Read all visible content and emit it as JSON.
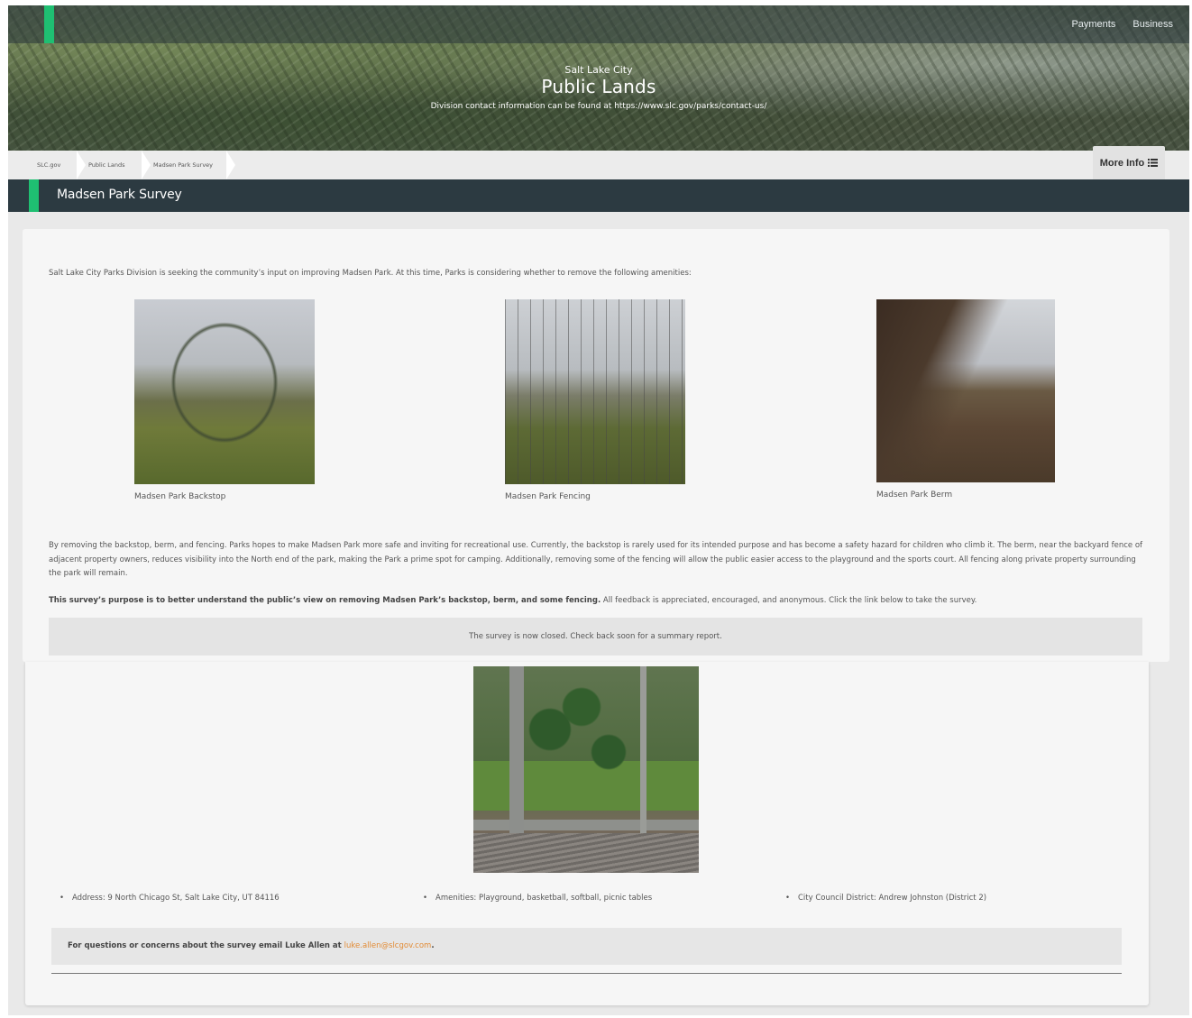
{
  "header": {
    "nav_links": [
      "Payments",
      "Business"
    ],
    "small_title": "Salt Lake City",
    "title": "Public Lands",
    "contact": "Division contact information can be found at https://www.slc.gov/parks/contact-us/"
  },
  "breadcrumb": {
    "items": [
      "SLC.gov",
      "Public Lands",
      "Madsen Park Survey"
    ],
    "more_info": "More Info"
  },
  "page_title": "Madsen Park Survey",
  "content": {
    "intro": "Salt Lake City Parks Division is seeking the community’s input on improving Madsen Park. At this time, Parks is considering whether to remove the following amenities:",
    "photos": [
      {
        "caption": "Madsen Park Backstop"
      },
      {
        "caption": "Madsen Park Fencing"
      },
      {
        "caption": "Madsen Park Berm"
      }
    ],
    "paragraph": "By removing the backstop, berm, and fencing. Parks hopes to make Madsen Park more safe and inviting for recreational use. Currently, the backstop is rarely used for its intended purpose and has become a safety hazard for children who climb it. The berm, near the backyard fence of adjacent property owners, reduces visibility into the North end of the park, making the Park a prime spot for camping. Additionally, removing some of the fencing will allow the public easier access to the playground and the sports court. All fencing along private property surrounding the park will remain.",
    "purpose_bold": "This survey’s purpose is to better understand the public’s view on removing Madsen Park’s backstop, berm, and some fencing.",
    "purpose_rest": " All feedback is appreciated, encouraged, and anonymous. Click the link below to take the survey.",
    "survey_status": "The survey is now closed. Check back soon for a summary report.",
    "facts": [
      "Address: 9 North Chicago St, Salt Lake City, UT 84116",
      "Amenities: Playground, basketball, softball, picnic tables",
      "City Council District: Andrew Johnston (District 2)"
    ],
    "contact_prefix": "For questions or concerns about the survey email Luke Allen at ",
    "contact_email": "luke.allen@slcgov.com",
    "contact_suffix": "."
  },
  "colors": {
    "accent": "#1fbf72",
    "titlebar": "#2c3a41",
    "link": "#e28a33"
  }
}
